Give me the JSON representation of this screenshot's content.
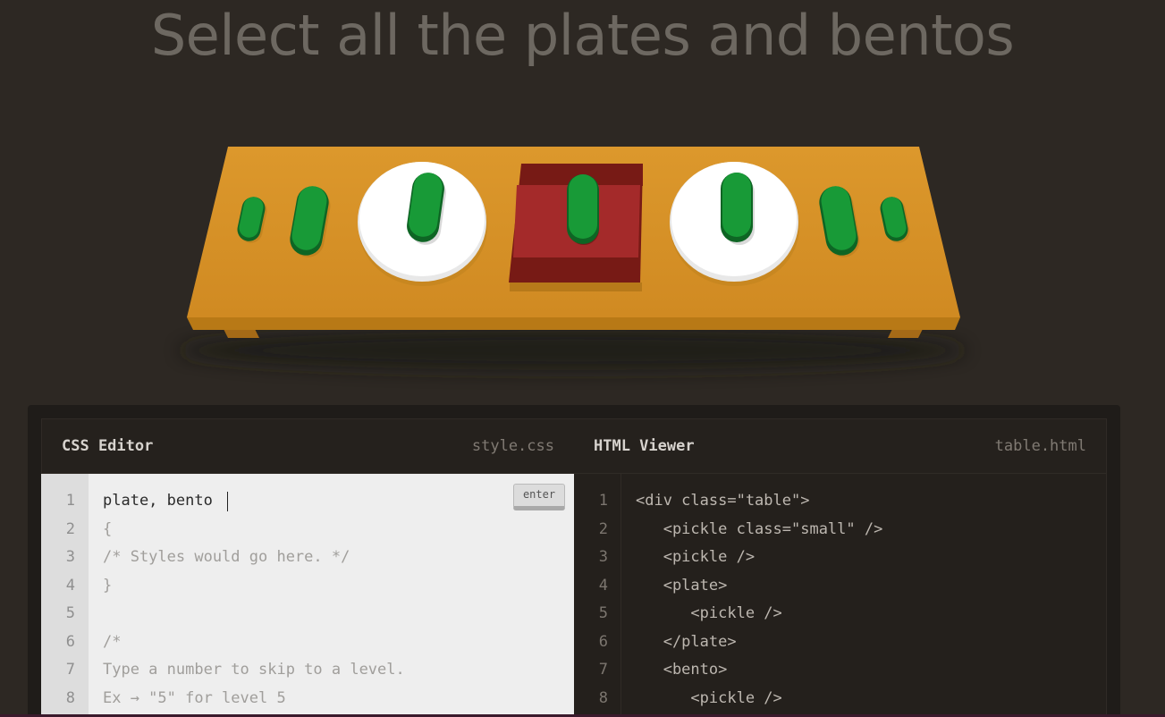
{
  "order": {
    "instruction": "Select all the plates and bentos"
  },
  "table": {
    "colors": {
      "wood_top": "#dc982c",
      "wood_edge": "#c5831f",
      "plate": "#ffffff",
      "bento": "#a42a2a",
      "pickle": "#189a37",
      "pickle_dark": "#0e6524"
    },
    "items": [
      "pickle small",
      "pickle",
      "plate with pickle",
      "bento with pickle",
      "plate with pickle",
      "pickle",
      "pickle small"
    ]
  },
  "css_editor": {
    "title": "CSS Editor",
    "filename": "style.css",
    "input_value": "plate, bento",
    "enter_label": "enter",
    "line_numbers": [
      "1",
      "2",
      "3",
      "4",
      "5",
      "6",
      "7",
      "8"
    ],
    "lines": [
      "{",
      "/* Styles would go here. */",
      "}",
      "",
      "/*",
      "Type a number to skip to a level.",
      "Ex → \"5\" for level 5"
    ]
  },
  "html_viewer": {
    "title": "HTML Viewer",
    "filename": "table.html",
    "line_numbers": [
      "1",
      "2",
      "3",
      "4",
      "5",
      "6",
      "7",
      "8"
    ],
    "lines": [
      "<div class=\"table\">",
      "   <pickle class=\"small\" />",
      "   <pickle />",
      "   <plate>",
      "      <pickle />",
      "   </plate>",
      "   <bento>",
      "      <pickle />"
    ]
  }
}
